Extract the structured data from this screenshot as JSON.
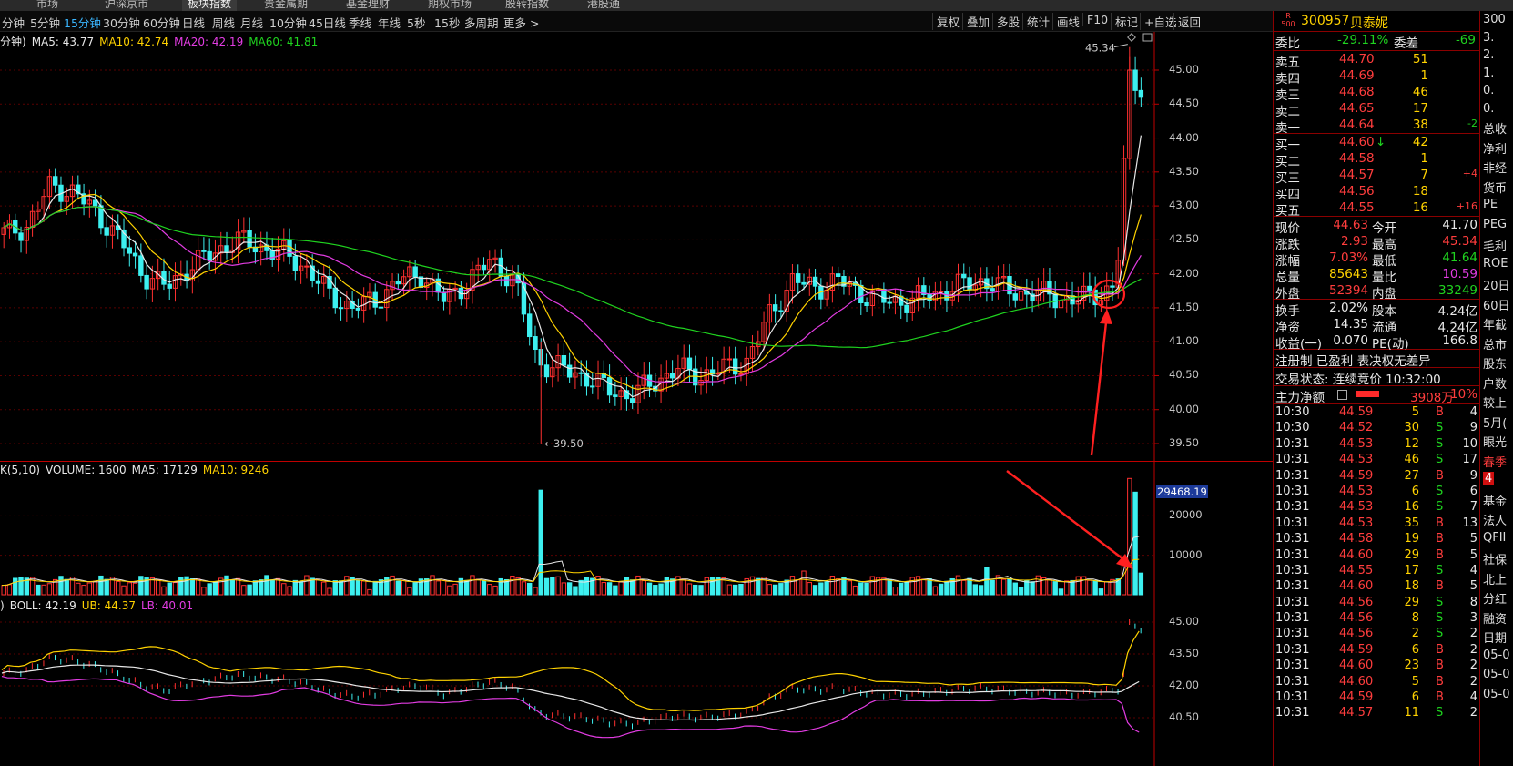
{
  "top_tabs": [
    "市场",
    "沪深京市",
    "板块指数",
    "贵金属期",
    "基金理财",
    "期权市场",
    "股转指数",
    "港股通"
  ],
  "toolbar": {
    "periods": [
      "分钟",
      "5分钟",
      "15分钟",
      "30分钟",
      "60分钟",
      "日线",
      "周线",
      "月线",
      "10分钟",
      "45日线",
      "季线",
      "年线",
      "5秒",
      "15秒",
      "多周期",
      "更多 >"
    ],
    "active_period": "15分钟",
    "right_buttons": [
      "复权",
      "叠加",
      "多股",
      "统计",
      "画线",
      "F10",
      "标记",
      "+自选",
      "返回"
    ]
  },
  "price_panel": {
    "legend_prefix": "分钟)",
    "ma": [
      {
        "label": "MA5: 43.77",
        "color": "#e8e8e8"
      },
      {
        "label": "MA10: 42.74",
        "color": "#ffd200"
      },
      {
        "label": "MA20: 42.19",
        "color": "#e23ce2"
      },
      {
        "label": "MA60: 41.81",
        "color": "#1fd21f"
      }
    ],
    "y_ticks": [
      "45.00",
      "44.50",
      "44.00",
      "43.50",
      "43.00",
      "42.50",
      "42.00",
      "41.50",
      "41.00",
      "40.50",
      "40.00",
      "39.50"
    ],
    "high_note": "45.34",
    "low_note": "39.50"
  },
  "volume_panel": {
    "legend": [
      {
        "label": "K(5,10)",
        "color": "#e8e8e8"
      },
      {
        "label": "VOLUME: 1600",
        "color": "#e8e8e8"
      },
      {
        "label": "MA5: 17129",
        "color": "#e8e8e8"
      },
      {
        "label": "MA10: 9246",
        "color": "#ffd200"
      }
    ],
    "y_ticks": [
      "20000",
      "10000"
    ],
    "current_value": "29468.19"
  },
  "boll_panel": {
    "legend": [
      {
        "label": ")",
        "color": "#e8e8e8"
      },
      {
        "label": "BOLL: 42.19",
        "color": "#e8e8e8"
      },
      {
        "label": "UB: 44.37",
        "color": "#ffd200"
      },
      {
        "label": "LB: 40.01",
        "color": "#e23ce2"
      }
    ],
    "y_ticks": [
      "45.00",
      "43.50",
      "42.00",
      "40.50"
    ]
  },
  "stock": {
    "code": "300957",
    "name": "贝泰妮",
    "badge_top": "R",
    "badge_bottom": "500"
  },
  "commission": {
    "ratio_label": "委比",
    "ratio": "-29.11%",
    "diff_label": "委差",
    "diff": "-69"
  },
  "asks": [
    {
      "label": "卖五",
      "price": "44.70",
      "vol": "51",
      "chg": ""
    },
    {
      "label": "卖四",
      "price": "44.69",
      "vol": "1",
      "chg": ""
    },
    {
      "label": "卖三",
      "price": "44.68",
      "vol": "46",
      "chg": ""
    },
    {
      "label": "卖二",
      "price": "44.65",
      "vol": "17",
      "chg": ""
    },
    {
      "label": "卖一",
      "price": "44.64",
      "vol": "38",
      "chg": "-2"
    }
  ],
  "bids": [
    {
      "label": "买一",
      "price": "44.60",
      "vol": "42",
      "chg": "",
      "arrow": "↓"
    },
    {
      "label": "买二",
      "price": "44.58",
      "vol": "1",
      "chg": ""
    },
    {
      "label": "买三",
      "price": "44.57",
      "vol": "7",
      "chg": "+4"
    },
    {
      "label": "买四",
      "price": "44.56",
      "vol": "18",
      "chg": ""
    },
    {
      "label": "买五",
      "price": "44.55",
      "vol": "16",
      "chg": "+16"
    }
  ],
  "quote": [
    {
      "l1": "现价",
      "v1": "44.63",
      "c1": "red",
      "l2": "今开",
      "v2": "41.70",
      "c2": "wht"
    },
    {
      "l1": "涨跌",
      "v1": "2.93",
      "c1": "red",
      "l2": "最高",
      "v2": "45.34",
      "c2": "red"
    },
    {
      "l1": "涨幅",
      "v1": "7.03%",
      "c1": "red",
      "l2": "最低",
      "v2": "41.64",
      "c2": "grn"
    },
    {
      "l1": "总量",
      "v1": "85643",
      "c1": "yel",
      "l2": "量比",
      "v2": "10.59",
      "c2": "mag"
    },
    {
      "l1": "外盘",
      "v1": "52394",
      "c1": "red",
      "l2": "内盘",
      "v2": "33249",
      "c2": "grn"
    }
  ],
  "fundamentals": [
    {
      "l1": "换手",
      "v1": "2.02%",
      "l2": "股本",
      "v2": "4.24亿"
    },
    {
      "l1": "净资",
      "v1": "14.35",
      "l2": "流通",
      "v2": "4.24亿"
    },
    {
      "l1": "收益(一)",
      "v1": "0.070",
      "l2": "PE(动)",
      "v2": "166.8"
    }
  ],
  "reg_note": "注册制 已盈利 表决权无差异",
  "trade_status": "交易状态: 连续竞价 10:32:00",
  "main_force": {
    "label": "主力净额",
    "value": "3908万",
    "pct": "10%"
  },
  "trades": [
    {
      "t": "10:30",
      "p": "44.59",
      "v": "5",
      "s": "B",
      "n": "4"
    },
    {
      "t": "10:30",
      "p": "44.52",
      "v": "30",
      "s": "S",
      "n": "9"
    },
    {
      "t": "10:31",
      "p": "44.53",
      "v": "12",
      "s": "S",
      "n": "10"
    },
    {
      "t": "10:31",
      "p": "44.53",
      "v": "46",
      "s": "S",
      "n": "17"
    },
    {
      "t": "10:31",
      "p": "44.59",
      "v": "27",
      "s": "B",
      "n": "9"
    },
    {
      "t": "10:31",
      "p": "44.53",
      "v": "6",
      "s": "S",
      "n": "6"
    },
    {
      "t": "10:31",
      "p": "44.53",
      "v": "16",
      "s": "S",
      "n": "7"
    },
    {
      "t": "10:31",
      "p": "44.53",
      "v": "35",
      "s": "B",
      "n": "13"
    },
    {
      "t": "10:31",
      "p": "44.58",
      "v": "19",
      "s": "B",
      "n": "5"
    },
    {
      "t": "10:31",
      "p": "44.60",
      "v": "29",
      "s": "B",
      "n": "5"
    },
    {
      "t": "10:31",
      "p": "44.55",
      "v": "17",
      "s": "S",
      "n": "4"
    },
    {
      "t": "10:31",
      "p": "44.60",
      "v": "18",
      "s": "B",
      "n": "5"
    },
    {
      "t": "10:31",
      "p": "44.56",
      "v": "29",
      "s": "S",
      "n": "8"
    },
    {
      "t": "10:31",
      "p": "44.56",
      "v": "8",
      "s": "S",
      "n": "3"
    },
    {
      "t": "10:31",
      "p": "44.56",
      "v": "2",
      "s": "S",
      "n": "2"
    },
    {
      "t": "10:31",
      "p": "44.59",
      "v": "6",
      "s": "B",
      "n": "2"
    },
    {
      "t": "10:31",
      "p": "44.60",
      "v": "23",
      "s": "B",
      "n": "2"
    },
    {
      "t": "10:31",
      "p": "44.60",
      "v": "5",
      "s": "B",
      "n": "2"
    },
    {
      "t": "10:31",
      "p": "44.59",
      "v": "6",
      "s": "B",
      "n": "4"
    },
    {
      "t": "10:31",
      "p": "44.57",
      "v": "11",
      "s": "S",
      "n": "2"
    }
  ],
  "far_right": [
    "300",
    "3.",
    "2.",
    "1.",
    "0.",
    "0.",
    "总收",
    "净利",
    "非经",
    "货币",
    "PE",
    "PEG",
    "毛利",
    "ROE",
    "20日",
    "60日",
    "年截",
    "总市",
    "股东",
    "户数",
    "较上",
    "5月(",
    "眼光",
    "春季",
    "4",
    "基金",
    "法人",
    "QFII",
    "社保",
    "北上",
    "分红",
    "融资",
    "日期",
    "05-0",
    "05-0",
    "05-0"
  ],
  "chart_data": {
    "type": "candlestick",
    "interval": "15分钟",
    "y_ticks": [
      45.0,
      44.5,
      44.0,
      43.5,
      43.0,
      42.5,
      42.0,
      41.5,
      41.0,
      40.5,
      40.0,
      39.5
    ],
    "ylim": [
      39.3,
      45.5
    ],
    "high": 45.34,
    "low": 39.5,
    "close_series": [
      42.6,
      42.7,
      43.3,
      43.2,
      42.9,
      42.5,
      42.0,
      41.8,
      42.1,
      42.3,
      42.5,
      42.4,
      42.3,
      42.1,
      41.7,
      41.5,
      41.6,
      41.9,
      42.0,
      41.6,
      41.9,
      42.2,
      41.9,
      40.7,
      40.6,
      40.5,
      40.3,
      40.2,
      40.4,
      40.6,
      40.5,
      40.6,
      40.7,
      41.4,
      41.9,
      41.8,
      41.9,
      41.7,
      41.6,
      41.6,
      41.7,
      41.8,
      41.9,
      41.8,
      41.7,
      41.7,
      41.6,
      41.7,
      41.8,
      44.6
    ],
    "volume_ylim": [
      0,
      30000
    ],
    "volume_ticks": [
      20000,
      10000
    ],
    "boll": {
      "mid": 42.19,
      "ub": 44.37,
      "lb": 40.01
    },
    "boll_ticks": [
      45.0,
      43.5,
      42.0,
      40.5
    ]
  }
}
